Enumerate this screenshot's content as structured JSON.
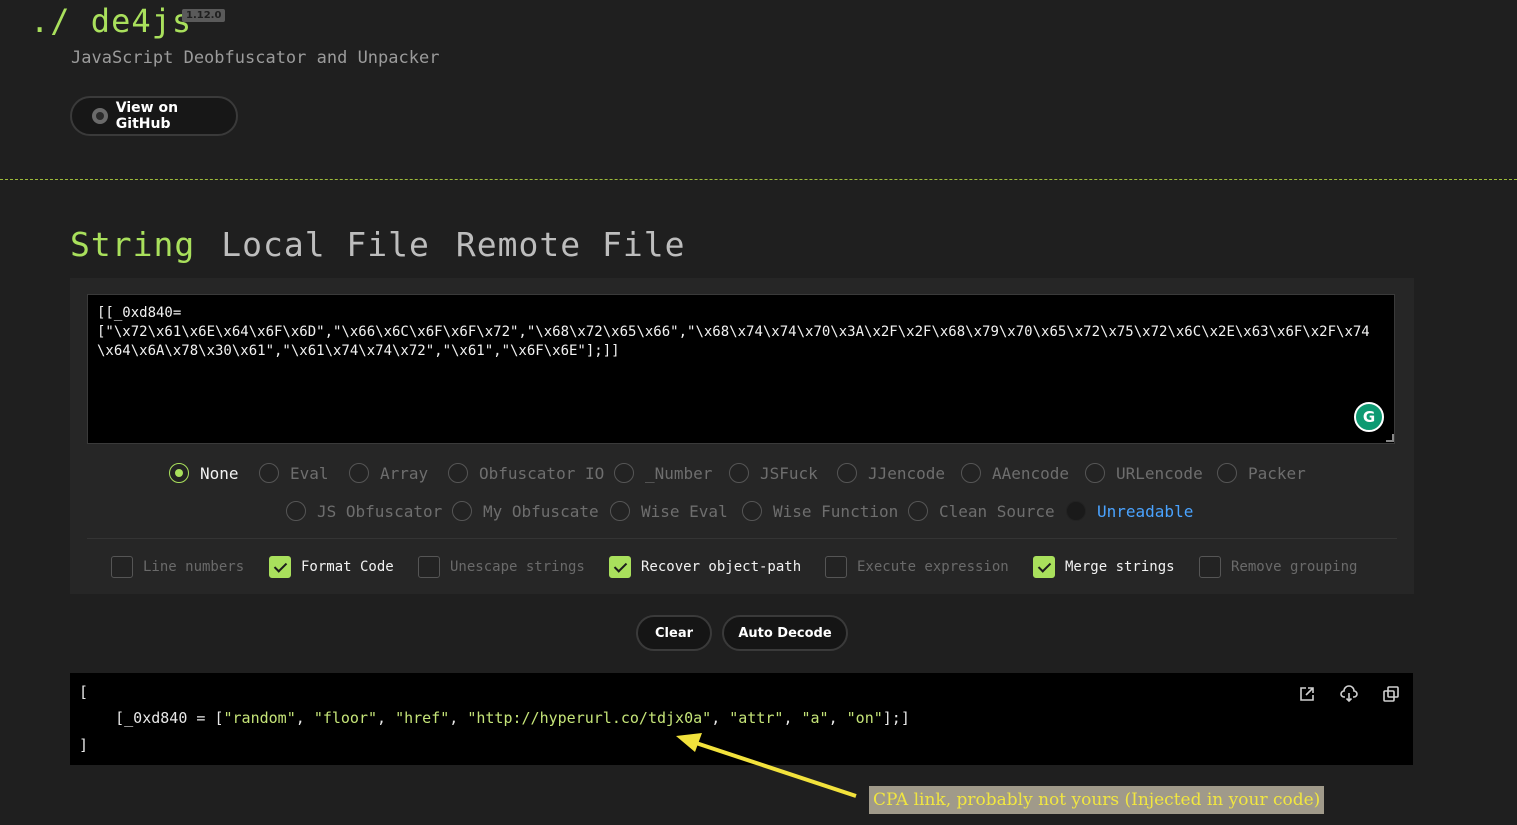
{
  "header": {
    "prefix": "./",
    "title": "de4js",
    "version": "1.12.0",
    "tagline": "JavaScript Deobfuscator and Unpacker",
    "github_label": "View on GitHub"
  },
  "tabs": [
    {
      "label": "String",
      "active": true
    },
    {
      "label": "Local File",
      "active": false
    },
    {
      "label": "Remote File",
      "active": false
    }
  ],
  "input": {
    "value": "[[_0xd840=\n[\"\\x72\\x61\\x6E\\x64\\x6F\\x6D\",\"\\x66\\x6C\\x6F\\x6F\\x72\",\"\\x68\\x72\\x65\\x66\",\"\\x68\\x74\\x74\\x70\\x3A\\x2F\\x2F\\x68\\x79\\x70\\x65\\x72\\x75\\x72\\x6C\\x2E\\x63\\x6F\\x2F\\x74\\x64\\x6A\\x78\\x30\\x61\",\"\\x61\\x74\\x74\\x72\",\"\\x61\",\"\\x6F\\x6E\"];]]",
    "grammarly_letter": "G"
  },
  "methods_row1": [
    {
      "label": "None",
      "selected": true
    },
    {
      "label": "Eval"
    },
    {
      "label": "Array"
    },
    {
      "label": "Obfuscator IO"
    },
    {
      "label": "_Number"
    },
    {
      "label": "JSFuck"
    },
    {
      "label": "JJencode"
    },
    {
      "label": "AAencode"
    },
    {
      "label": "URLencode"
    },
    {
      "label": "Packer"
    }
  ],
  "methods_row2": [
    {
      "label": "JS Obfuscator"
    },
    {
      "label": "My Obfuscate"
    },
    {
      "label": "Wise Eval"
    },
    {
      "label": "Wise Function"
    },
    {
      "label": "Clean Source"
    },
    {
      "label": "Unreadable",
      "link": true
    }
  ],
  "options": [
    {
      "label": "Line numbers",
      "checked": false
    },
    {
      "label": "Format Code",
      "checked": true
    },
    {
      "label": "Unescape strings",
      "checked": false
    },
    {
      "label": "Recover object-path",
      "checked": true
    },
    {
      "label": "Execute expression",
      "checked": false
    },
    {
      "label": "Merge strings",
      "checked": true
    },
    {
      "label": "Remove grouping",
      "checked": false
    }
  ],
  "actions": {
    "clear": "Clear",
    "auto_decode": "Auto Decode"
  },
  "output": {
    "line1": "[",
    "var_prefix": "    [_0xd840 = [",
    "strings": [
      "\"random\"",
      "\"floor\"",
      "\"href\"",
      "\"http://hyperurl.co/tdjx0a\"",
      "\"attr\"",
      "\"a\"",
      "\"on\""
    ],
    "suffix": "];]",
    "line3": "]",
    "icons": [
      "open-external-icon",
      "download-icon",
      "copy-icon"
    ]
  },
  "annotation": {
    "text": "CPA link, probably not yours (Injected in your code)",
    "color": "#f1e640",
    "arrow_color": "#f2e23c"
  },
  "colors": {
    "accent": "#a9e05c",
    "background": "#1f1f1f",
    "link": "#4aa3ff"
  }
}
